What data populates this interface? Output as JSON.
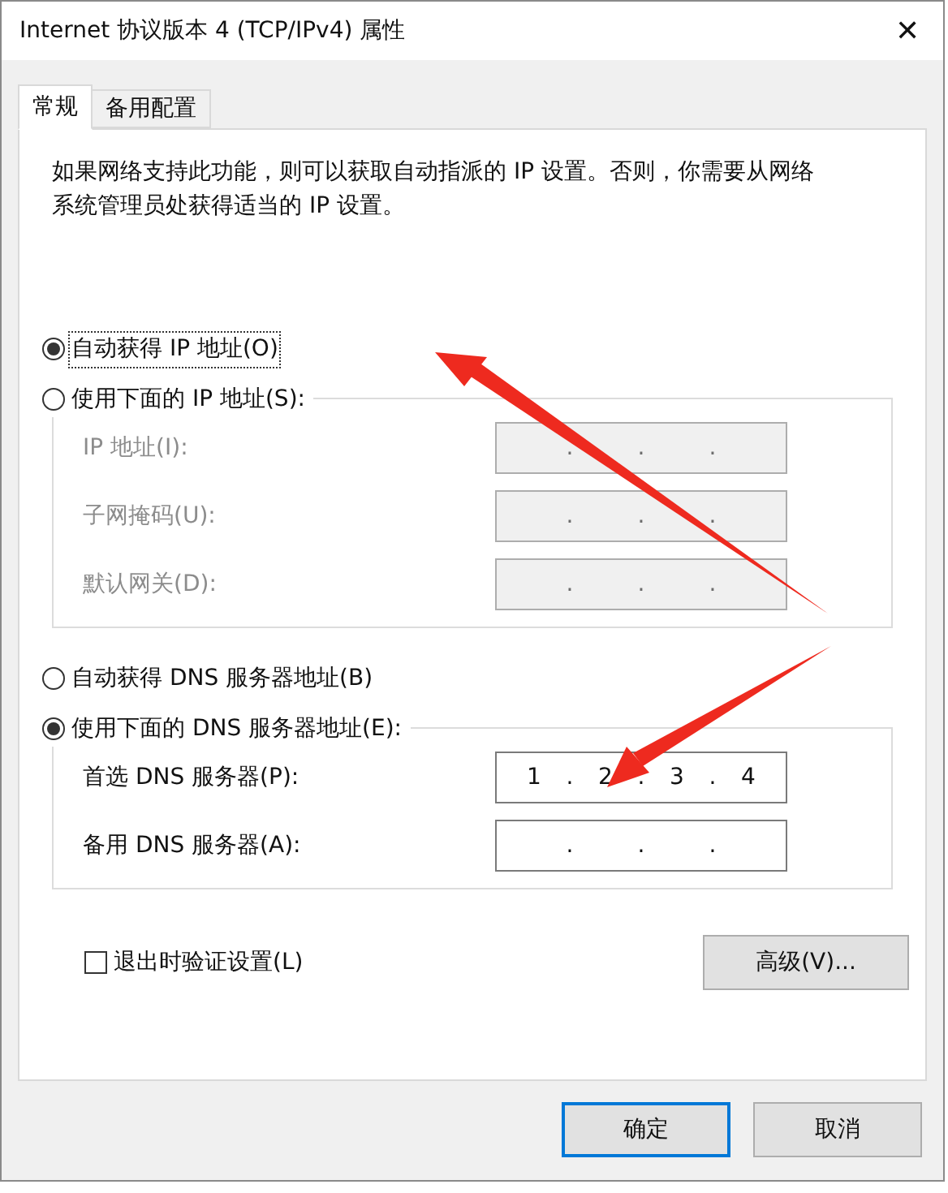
{
  "window": {
    "title": "Internet 协议版本 4 (TCP/IPv4) 属性",
    "close": "✕"
  },
  "tabs": [
    {
      "label": "常规",
      "selected": true
    },
    {
      "label": "备用配置",
      "selected": false
    }
  ],
  "description": "如果网络支持此功能，则可以获取自动指派的 IP 设置。否则，你需要从网络系统管理员处获得适当的 IP 设置。",
  "ip_section": {
    "options": [
      {
        "label": "自动获得 IP 地址(O)",
        "selected": true,
        "focused": true
      },
      {
        "label": "使用下面的 IP 地址(S):",
        "selected": false,
        "focused": false
      }
    ],
    "disabled": true,
    "fields": [
      {
        "label": "IP 地址(I):",
        "dots": [
          ".",
          ".",
          "."
        ]
      },
      {
        "label": "子网掩码(U):",
        "dots": [
          ".",
          ".",
          "."
        ]
      },
      {
        "label": "默认网关(D):",
        "dots": [
          ".",
          ".",
          "."
        ]
      }
    ]
  },
  "dns_section": {
    "options": [
      {
        "label": "自动获得 DNS 服务器地址(B)",
        "selected": false,
        "focused": false
      },
      {
        "label": "使用下面的 DNS 服务器地址(E):",
        "selected": true,
        "focused": false
      }
    ],
    "disabled": false,
    "fields": [
      {
        "label": "首选 DNS 服务器(P):",
        "octets": [
          "1",
          "2",
          "3",
          "4"
        ],
        "dots": [
          ".",
          ".",
          "."
        ]
      },
      {
        "label": "备用 DNS 服务器(A):",
        "dots": [
          ".",
          ".",
          "."
        ]
      }
    ]
  },
  "validate_checkbox": {
    "label": "退出时验证设置(L)",
    "checked": false
  },
  "advanced_button": "高级(V)...",
  "buttons": [
    {
      "label": "确定",
      "default": true
    },
    {
      "label": "取消",
      "default": false
    }
  ]
}
